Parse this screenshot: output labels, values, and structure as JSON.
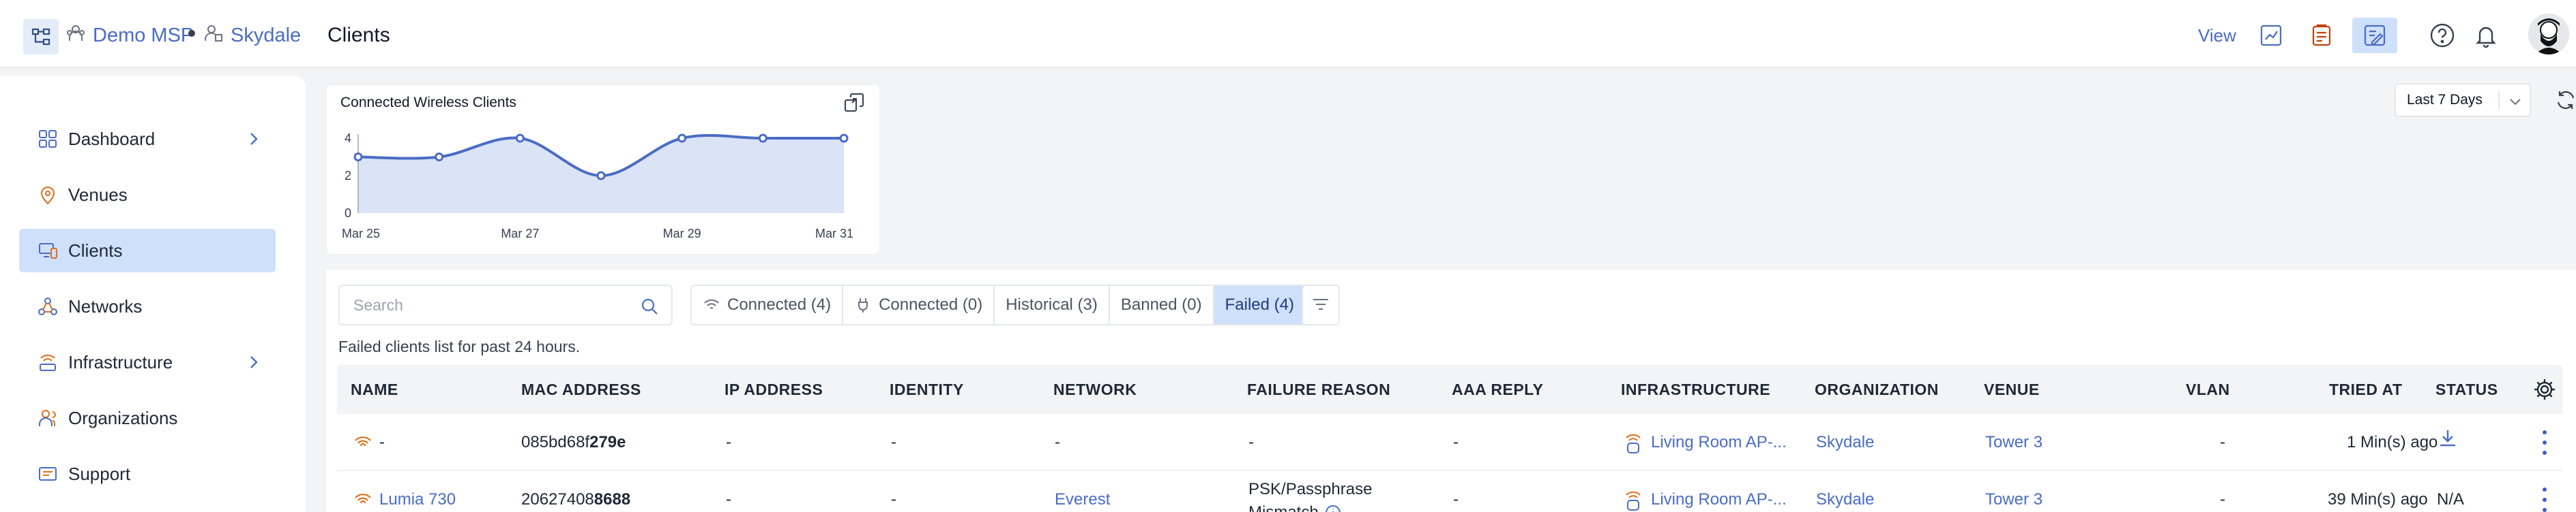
{
  "header": {
    "org": "Demo MSP",
    "site": "Skydale",
    "page_title": "Clients",
    "view_label": "View"
  },
  "sidebar": {
    "items": [
      {
        "label": "Dashboard",
        "icon": "dashboard-icon",
        "has_chevron": true
      },
      {
        "label": "Venues",
        "icon": "location-pin-icon"
      },
      {
        "label": "Clients",
        "icon": "clients-icon",
        "active": true
      },
      {
        "label": "Networks",
        "icon": "networks-icon"
      },
      {
        "label": "Infrastructure",
        "icon": "infrastructure-icon",
        "has_chevron": true
      },
      {
        "label": "Organizations",
        "icon": "organizations-icon"
      },
      {
        "label": "Support",
        "icon": "support-icon"
      }
    ]
  },
  "chart": {
    "title": "Connected Wireless Clients"
  },
  "chart_data": {
    "type": "area",
    "title": "Connected Wireless Clients",
    "x": [
      "Mar 25",
      "Mar 26",
      "Mar 27",
      "Mar 28",
      "Mar 29",
      "Mar 30",
      "Mar 31"
    ],
    "x_tick_labels": [
      "Mar 25",
      "Mar 27",
      "Mar 29",
      "Mar 31"
    ],
    "values": [
      3,
      3,
      4,
      2,
      4,
      4,
      4
    ],
    "y_ticks": [
      "4",
      "2",
      "0"
    ],
    "ylim": [
      0,
      4
    ],
    "color": "#4a6cc4",
    "fill": "#dbe3f7",
    "grid": false
  },
  "range": {
    "selected": "Last 7 Days"
  },
  "search": {
    "placeholder": "Search"
  },
  "filters": [
    {
      "label": "Connected (4)",
      "icon": "wifi-icon"
    },
    {
      "label": "Connected (0)",
      "icon": "wired-plug-icon"
    },
    {
      "label": "Historical (3)"
    },
    {
      "label": "Banned (0)"
    },
    {
      "label": "Failed (4)",
      "active": true
    }
  ],
  "note": "Failed clients list for past 24 hours.",
  "table": {
    "columns": [
      "NAME",
      "MAC ADDRESS",
      "IP ADDRESS",
      "IDENTITY",
      "NETWORK",
      "FAILURE REASON",
      "AAA REPLY",
      "INFRASTRUCTURE",
      "ORGANIZATION",
      "VENUE",
      "VLAN",
      "TRIED AT",
      "STATUS"
    ],
    "rows": [
      {
        "name": "-",
        "mac_prefix": "085bd68f",
        "mac_suffix": "279e",
        "ip": "-",
        "identity": "-",
        "network": "-",
        "failure_reason": "-",
        "aaa_reply": "-",
        "infrastructure": "Living Room AP-...",
        "organization": "Skydale",
        "venue": "Tower 3",
        "vlan": "-",
        "tried_at": "1 Min(s) ago",
        "status": "download"
      },
      {
        "name": "Lumia 730",
        "mac_prefix": "20627408",
        "mac_suffix": "8688",
        "ip": "-",
        "identity": "-",
        "network": "Everest",
        "failure_reason": "PSK/Passphrase",
        "failure_reason_2": "Mismatch",
        "aaa_reply": "-",
        "infrastructure": "Living Room AP-...",
        "organization": "Skydale",
        "venue": "Tower 3",
        "vlan": "-",
        "tried_at": "39 Min(s) ago",
        "status": "N/A"
      }
    ]
  }
}
